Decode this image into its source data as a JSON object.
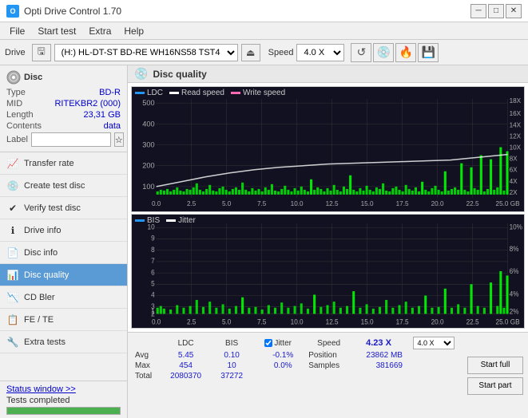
{
  "titlebar": {
    "title": "Opti Drive Control 1.70",
    "icon_label": "O",
    "minimize": "─",
    "maximize": "□",
    "close": "✕"
  },
  "menubar": {
    "items": [
      "File",
      "Start test",
      "Extra",
      "Help"
    ]
  },
  "drivebar": {
    "drive_label": "Drive",
    "drive_value": "(H:) HL-DT-ST BD-RE  WH16NS58 TST4",
    "speed_label": "Speed",
    "speed_value": "4.0 X"
  },
  "disc_info": {
    "title": "Disc",
    "type_label": "Type",
    "type_value": "BD-R",
    "mid_label": "MID",
    "mid_value": "RITEKBR2 (000)",
    "length_label": "Length",
    "length_value": "23,31 GB",
    "contents_label": "Contents",
    "contents_value": "data",
    "label_label": "Label",
    "label_value": ""
  },
  "nav": {
    "items": [
      {
        "id": "transfer-rate",
        "label": "Transfer rate",
        "icon": "📈"
      },
      {
        "id": "create-test-disc",
        "label": "Create test disc",
        "icon": "💿"
      },
      {
        "id": "verify-test-disc",
        "label": "Verify test disc",
        "icon": "✔"
      },
      {
        "id": "drive-info",
        "label": "Drive info",
        "icon": "ℹ"
      },
      {
        "id": "disc-info",
        "label": "Disc info",
        "icon": "📄"
      },
      {
        "id": "disc-quality",
        "label": "Disc quality",
        "icon": "📊",
        "active": true
      },
      {
        "id": "cd-bler",
        "label": "CD Bler",
        "icon": "📉"
      },
      {
        "id": "fe-te",
        "label": "FE / TE",
        "icon": "📋"
      },
      {
        "id": "extra-tests",
        "label": "Extra tests",
        "icon": "🔧"
      }
    ]
  },
  "status": {
    "window_label": "Status window >>",
    "text": "Tests completed",
    "progress": 100
  },
  "content": {
    "header_icon": "💿",
    "header_title": "Disc quality"
  },
  "chart_top": {
    "legend": [
      {
        "label": "LDC",
        "color": "#2196F3"
      },
      {
        "label": "Read speed",
        "color": "#ffffff"
      },
      {
        "label": "Write speed",
        "color": "#ff69b4"
      }
    ],
    "y_axis": [
      500,
      400,
      300,
      200,
      100
    ],
    "y_axis_right": [
      "18X",
      "16X",
      "14X",
      "12X",
      "10X",
      "8X",
      "6X",
      "4X",
      "2X"
    ],
    "x_axis": [
      "0.0",
      "2.5",
      "5.0",
      "7.5",
      "10.0",
      "12.5",
      "15.0",
      "17.5",
      "20.0",
      "22.5",
      "25.0 GB"
    ]
  },
  "chart_bottom": {
    "legend": [
      {
        "label": "BIS",
        "color": "#2196F3"
      },
      {
        "label": "Jitter",
        "color": "#ffffff"
      }
    ],
    "y_axis_left": [
      "10",
      "9",
      "8",
      "7",
      "6",
      "5",
      "4",
      "3",
      "2",
      "1"
    ],
    "y_axis_right": [
      "10%",
      "8%",
      "6%",
      "4%",
      "2%"
    ],
    "x_axis": [
      "0.0",
      "2.5",
      "5.0",
      "7.5",
      "10.0",
      "12.5",
      "15.0",
      "17.5",
      "20.0",
      "22.5",
      "25.0 GB"
    ]
  },
  "stats": {
    "columns": [
      "",
      "LDC",
      "BIS",
      "",
      "Jitter",
      "Speed",
      ""
    ],
    "rows": [
      {
        "label": "Avg",
        "ldc": "5.45",
        "bis": "0.10",
        "jitter": "-0.1%",
        "speed_label": "Position",
        "speed_val": "23862 MB"
      },
      {
        "label": "Max",
        "ldc": "454",
        "bis": "10",
        "jitter": "0.0%",
        "speed_label": "Samples",
        "speed_val": "381669"
      },
      {
        "label": "Total",
        "ldc": "2080370",
        "bis": "37272",
        "jitter": "",
        "speed_label": "",
        "speed_val": ""
      }
    ],
    "jitter_checked": true,
    "jitter_label": "Jitter",
    "speed_label": "Speed",
    "speed_value": "4.23 X",
    "speed_select": "4.0 X",
    "start_full_label": "Start full",
    "start_part_label": "Start part"
  }
}
